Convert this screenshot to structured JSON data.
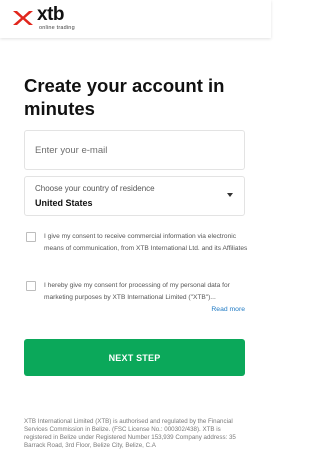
{
  "header": {
    "logo_text": "xtb",
    "logo_subtitle": "online trading"
  },
  "main": {
    "title": "Create your account in minutes"
  },
  "form": {
    "email": {
      "placeholder": "Enter your e-mail",
      "value": ""
    },
    "country": {
      "label": "Choose your country of residence",
      "value": "United States"
    },
    "consents": [
      {
        "text": "I give my consent to receive commercial information via electronic means of communication, from XTB International Ltd. and its Affiliates",
        "checked": false
      },
      {
        "text": "I hereby give my consent for processing of my personal data for marketing purposes by XTB International Limited (\"XTB\")...",
        "checked": false
      }
    ],
    "read_more_label": "Read more",
    "submit_label": "NEXT STEP"
  },
  "footer": {
    "legal_text": "XTB International Limited (XTB) is authorised and regulated by the Financial Services Commission in Belize. (FSC License No.: 000302/438). XTB is registered in Belize under Registered Number 153,939 Company address: 35 Barrack Road, 3rd Floor, Belize City, Belize, C.A"
  },
  "colors": {
    "accent_green": "#0ba85a",
    "logo_red": "#e1261c",
    "link_blue": "#1f7ac4"
  }
}
